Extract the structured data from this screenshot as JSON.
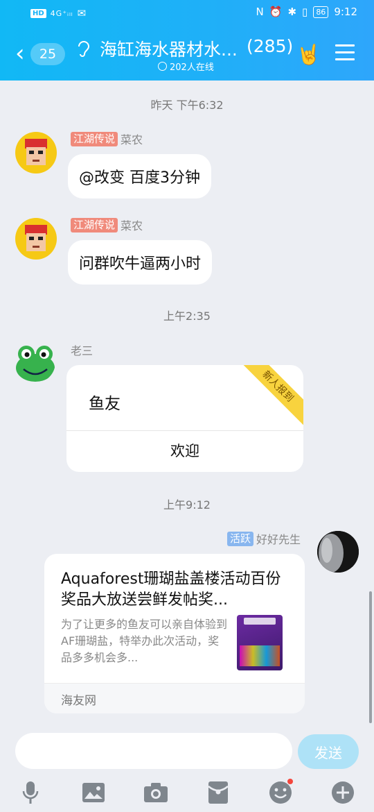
{
  "status_bar": {
    "network": "HD",
    "signal": "4G⁺ᵢₗₗ",
    "battery": "86",
    "time": "9:12"
  },
  "header": {
    "back_count": "25",
    "title": "海缸海水器材水...",
    "member_count": "(285)",
    "online": "202人在线"
  },
  "messages": [
    {
      "time": "昨天 下午6:32"
    },
    {
      "tag": "江湖传说",
      "sender": "菜农",
      "text": "@改变 百度3分钟"
    },
    {
      "tag": "江湖传说",
      "sender": "菜农",
      "text": "问群吹牛逼两小时"
    },
    {
      "time": "上午2:35"
    },
    {
      "sender": "老三",
      "card_text": "鱼友",
      "card_action": "欢迎",
      "ribbon": "新人报到"
    },
    {
      "time": "上午9:12"
    },
    {
      "tag": "活跃",
      "sender": "好好先生",
      "link_title": "Aquaforest珊瑚盐盖楼活动百份奖品大放送尝鲜发帖奖...",
      "link_desc": "为了让更多的鱼友可以亲自体验到AF珊瑚盐，特举办此次活动，奖品多多机会多...",
      "link_source": "海友网"
    }
  ],
  "input": {
    "placeholder": "",
    "send_label": "发送"
  },
  "colors": {
    "header": "#1fb0f8",
    "tag_red": "#f08a7b",
    "tag_blue": "#88b6ef",
    "send": "#aee2f7",
    "ribbon": "#f8d33e"
  },
  "icons": [
    "mic-icon",
    "image-icon",
    "camera-icon",
    "red-packet-icon",
    "emoji-icon",
    "plus-icon"
  ]
}
